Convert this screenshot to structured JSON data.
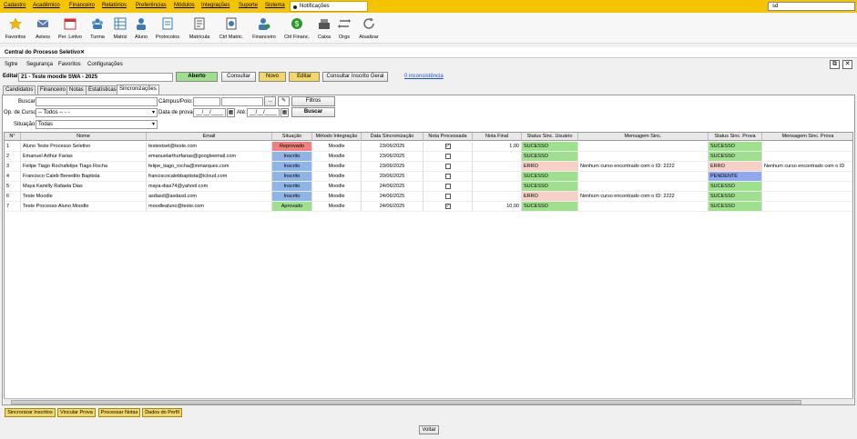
{
  "menu": [
    "Cadastro",
    "Acadêmico",
    "Financeiro",
    "Relatórios",
    "Preferências",
    "Módulos",
    "Integrações",
    "Suporte",
    "Sistema"
  ],
  "notifications_label": "Notificações",
  "search_value": "sd",
  "toolbar": [
    "Favoritos",
    "Avisos",
    "Per. Letivo",
    "Turma",
    "Matriz",
    "Aluno",
    "Protocolos",
    "Matrícula",
    "Ctrl Matric.",
    "Financeiro",
    "Ctrl Financ.",
    "Caixa",
    "Orgs",
    "Atualizar"
  ],
  "window_tab": "Central do Processo Seletivo",
  "submenu": [
    "Sgtre",
    "Segurança",
    "Favoritos",
    "Configurações"
  ],
  "edital": {
    "label": "Edital",
    "value": "21 - Teste moodle SWA - 2025",
    "status": "Aberto",
    "consultar": "Consultar",
    "novo": "Novo",
    "editar": "Editar",
    "consultar_inscrito": "Consultar Inscrito Geral",
    "inconsistencia": "0 inconsistência"
  },
  "tabs": [
    "Candidatos",
    "Financeiro",
    "Notas",
    "Estatísticas",
    "Sincronizações"
  ],
  "filters": {
    "buscar": "Buscar:",
    "campus": "Câmpus/Polo:",
    "filtros_btn": "Filtros",
    "op_curso": "Op. de Curso:",
    "op_curso_value": "-- Todos -- - -",
    "data_prova": "Data de prova:",
    "date_placeholder": "__/__/____",
    "ate": "Até:",
    "buscar_btn": "Buscar",
    "situacao": "Situação:",
    "situacao_value": "Todas"
  },
  "columns": [
    "N°",
    "Nome",
    "Email",
    "Situação",
    "Método Integração",
    "Data Sincronização",
    "Nota Processada",
    "Nota Final",
    "Status Sinc. Usuário",
    "Mensagem Sinc.",
    "Status Sinc. Prova",
    "Mensagem Sinc. Prova"
  ],
  "rows": [
    {
      "n": "1",
      "nome": "Aluno Teste Processo Seletivo",
      "email": "testestset@teste.com",
      "situacao": "Reprovado",
      "metodo": "Moodle",
      "data": "23/06/2025",
      "nota_proc": true,
      "nota_final": "1,00",
      "st_user": "SUCESSO",
      "msg": "",
      "st_prova": "SUCESSO",
      "msg_prova": ""
    },
    {
      "n": "2",
      "nome": "Emanuel Arthur Farias",
      "email": "emanuelarthurfarias@googleemail.com",
      "situacao": "Inscrito",
      "metodo": "Moodle",
      "data": "23/06/2025",
      "nota_proc": false,
      "nota_final": "",
      "st_user": "SUCESSO",
      "msg": "",
      "st_prova": "SUCESSO",
      "msg_prova": ""
    },
    {
      "n": "3",
      "nome": "Felipe Tiago Rochafelipe Tiago Rocha",
      "email": "felipe_tiago_rocha@mmarques.com",
      "situacao": "Inscrito",
      "metodo": "Moodle",
      "data": "23/06/2025",
      "nota_proc": false,
      "nota_final": "",
      "st_user": "ERRO",
      "msg": "Nenhum curso encontrado com o ID: 2222",
      "st_prova": "ERRO",
      "msg_prova": "Nenhum curso encontrado com o ID"
    },
    {
      "n": "4",
      "nome": "Francisco Caleb Benedito Baptista",
      "email": "franciscocalebbaptista@icloud.com",
      "situacao": "Inscrito",
      "metodo": "Moodle",
      "data": "20/06/2025",
      "nota_proc": false,
      "nota_final": "",
      "st_user": "SUCESSO",
      "msg": "",
      "st_prova": "PENDENTE",
      "msg_prova": ""
    },
    {
      "n": "5",
      "nome": "Maya Kamilly Rafaela Dias",
      "email": "maya-dias74@yahool.com",
      "situacao": "Inscrito",
      "metodo": "Moodle",
      "data": "24/06/2025",
      "nota_proc": false,
      "nota_final": "",
      "st_user": "SUCESSO",
      "msg": "",
      "st_prova": "SUCESSO",
      "msg_prova": ""
    },
    {
      "n": "6",
      "nome": "Teste Moodle",
      "email": "asdasd@asdasd.com",
      "situacao": "Inscrito",
      "metodo": "Moodle",
      "data": "24/06/2025",
      "nota_proc": false,
      "nota_final": "",
      "st_user": "ERRO",
      "msg": "Nenhum curso encontrado com o ID: 2222",
      "st_prova": "SUCESSO",
      "msg_prova": ""
    },
    {
      "n": "7",
      "nome": "Teste Processo Aluno Moodle",
      "email": "moodlealuno@teste.com",
      "situacao": "Aprovado",
      "metodo": "Moodle",
      "data": "24/06/2025",
      "nota_proc": true,
      "nota_final": "10,00",
      "st_user": "SUCESSO",
      "msg": "",
      "st_prova": "SUCESSO",
      "msg_prova": ""
    }
  ],
  "status_colors": {
    "Reprovado": "#f08080",
    "Inscrito": "#8fb4e8",
    "Aprovado": "#9fe08f",
    "SUCESSO": "#9fe08f",
    "ERRO": "#f8d0c8",
    "PENDENTE": "#8fa8f0"
  },
  "bottom_buttons": [
    "Sincronizar Inscritos",
    "Vincular Prova",
    "Processar Notas",
    "Dados do Perfil"
  ],
  "voltar": "Voltar"
}
